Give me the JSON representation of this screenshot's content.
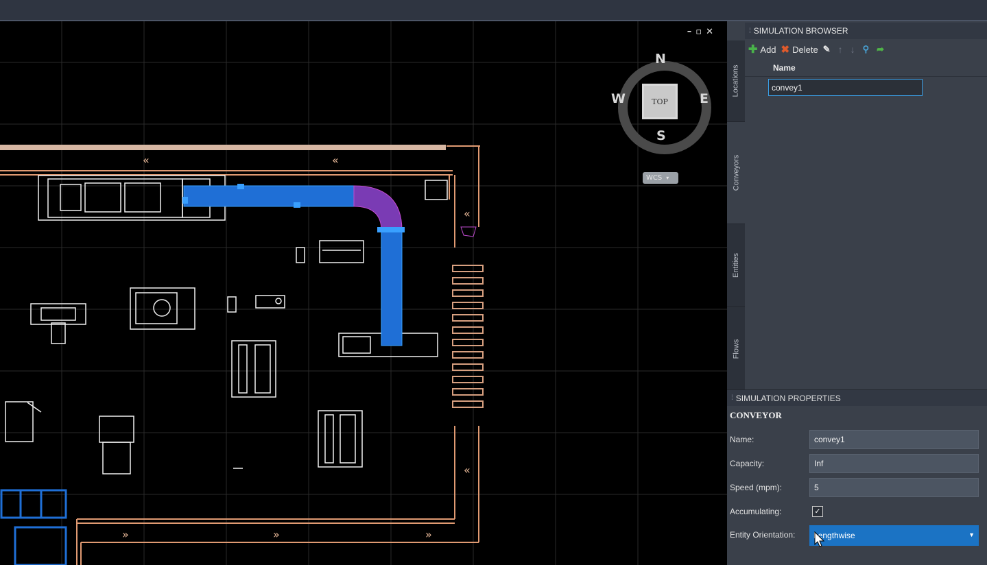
{
  "viewport": {
    "window_controls": [
      "–",
      "▫",
      "✕"
    ],
    "viewcube": {
      "north": "N",
      "south": "S",
      "east": "E",
      "west": "W",
      "face": "TOP",
      "coord_system": "WCS"
    }
  },
  "browser": {
    "title": "SIMULATION BROWSER",
    "tabs": [
      "Locations",
      "Conveyors",
      "Entities",
      "Flows"
    ],
    "active_tab": "Conveyors",
    "toolbar": {
      "add": "Add",
      "delete": "Delete"
    },
    "column_name": "Name",
    "rows": [
      {
        "name": "convey1"
      }
    ]
  },
  "properties": {
    "title": "SIMULATION PROPERTIES",
    "section": "CONVEYOR",
    "name_label": "Name:",
    "name_value": "convey1",
    "capacity_label": "Capacity:",
    "capacity_value": "Inf",
    "speed_label": "Speed (mpm):",
    "speed_value": "5",
    "accumulating_label": "Accumulating:",
    "accumulating_checked": true,
    "orientation_label": "Entity Orientation:",
    "orientation_value": "Lengthwise"
  },
  "colors": {
    "accent": "#1b73c4",
    "conveyor": "#1f6fd6",
    "walkway": "#e09a72",
    "curve": "#c04bd0"
  }
}
